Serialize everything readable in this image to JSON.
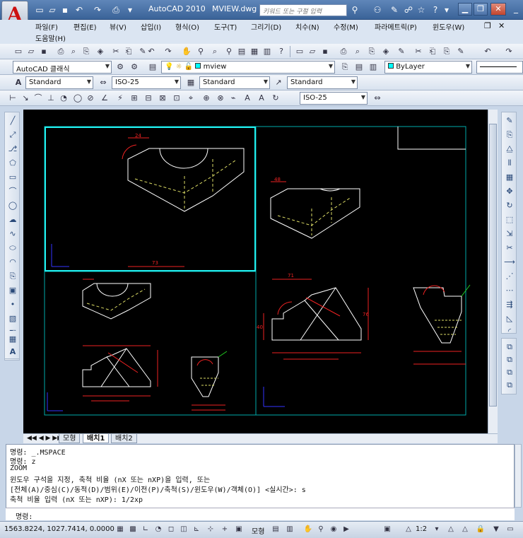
{
  "titlebar": {
    "app_name": "AutoCAD 2010",
    "file_name": "MVIEW.dwg",
    "search_placeholder": "키워드 또는 구절 입력",
    "app_logo_letter": "A"
  },
  "menus": [
    "파일(F)",
    "편집(E)",
    "뷰(V)",
    "삽입(I)",
    "형식(O)",
    "도구(T)",
    "그리기(D)",
    "치수(N)",
    "수정(M)",
    "파라메트릭(P)",
    "윈도우(W)",
    "도움말(H)"
  ],
  "toolbar3": {
    "workspace": "AutoCAD 클래식",
    "layer": "mview",
    "color": "ByLayer"
  },
  "toolbar4": {
    "text_style": "Standard",
    "dim_style": "ISO-25",
    "table_style": "Standard",
    "mleader_style": "Standard"
  },
  "toolbar5": {
    "dim_style": "ISO-25"
  },
  "tabs": [
    "모형",
    "배치1",
    "배치2"
  ],
  "active_tab": "배치1",
  "command_history": [
    "명령: _.MSPACE",
    "명령: z",
    "ZOOM",
    "윈도우 구석을 지정, 축척 비율 (nX 또는 nXP)을 입력, 또는",
    "[전체(A)/중심(C)/동적(D)/범위(E)/이전(P)/축척(S)/윈도우(W)/객체(O)] <실시간>: s",
    "축척 비율 입력 (nX 또는 nXP): 1/2xp"
  ],
  "command_prompt": "명령:",
  "status": {
    "coordinates": "1563.8224, 1027.7414, 0.0000",
    "model_label": "모형",
    "scale": "1:2"
  },
  "drawing": {
    "dims": [
      "24",
      "73",
      "48",
      "71",
      "71",
      "76",
      "40",
      "54",
      "64",
      "80",
      "60"
    ]
  }
}
